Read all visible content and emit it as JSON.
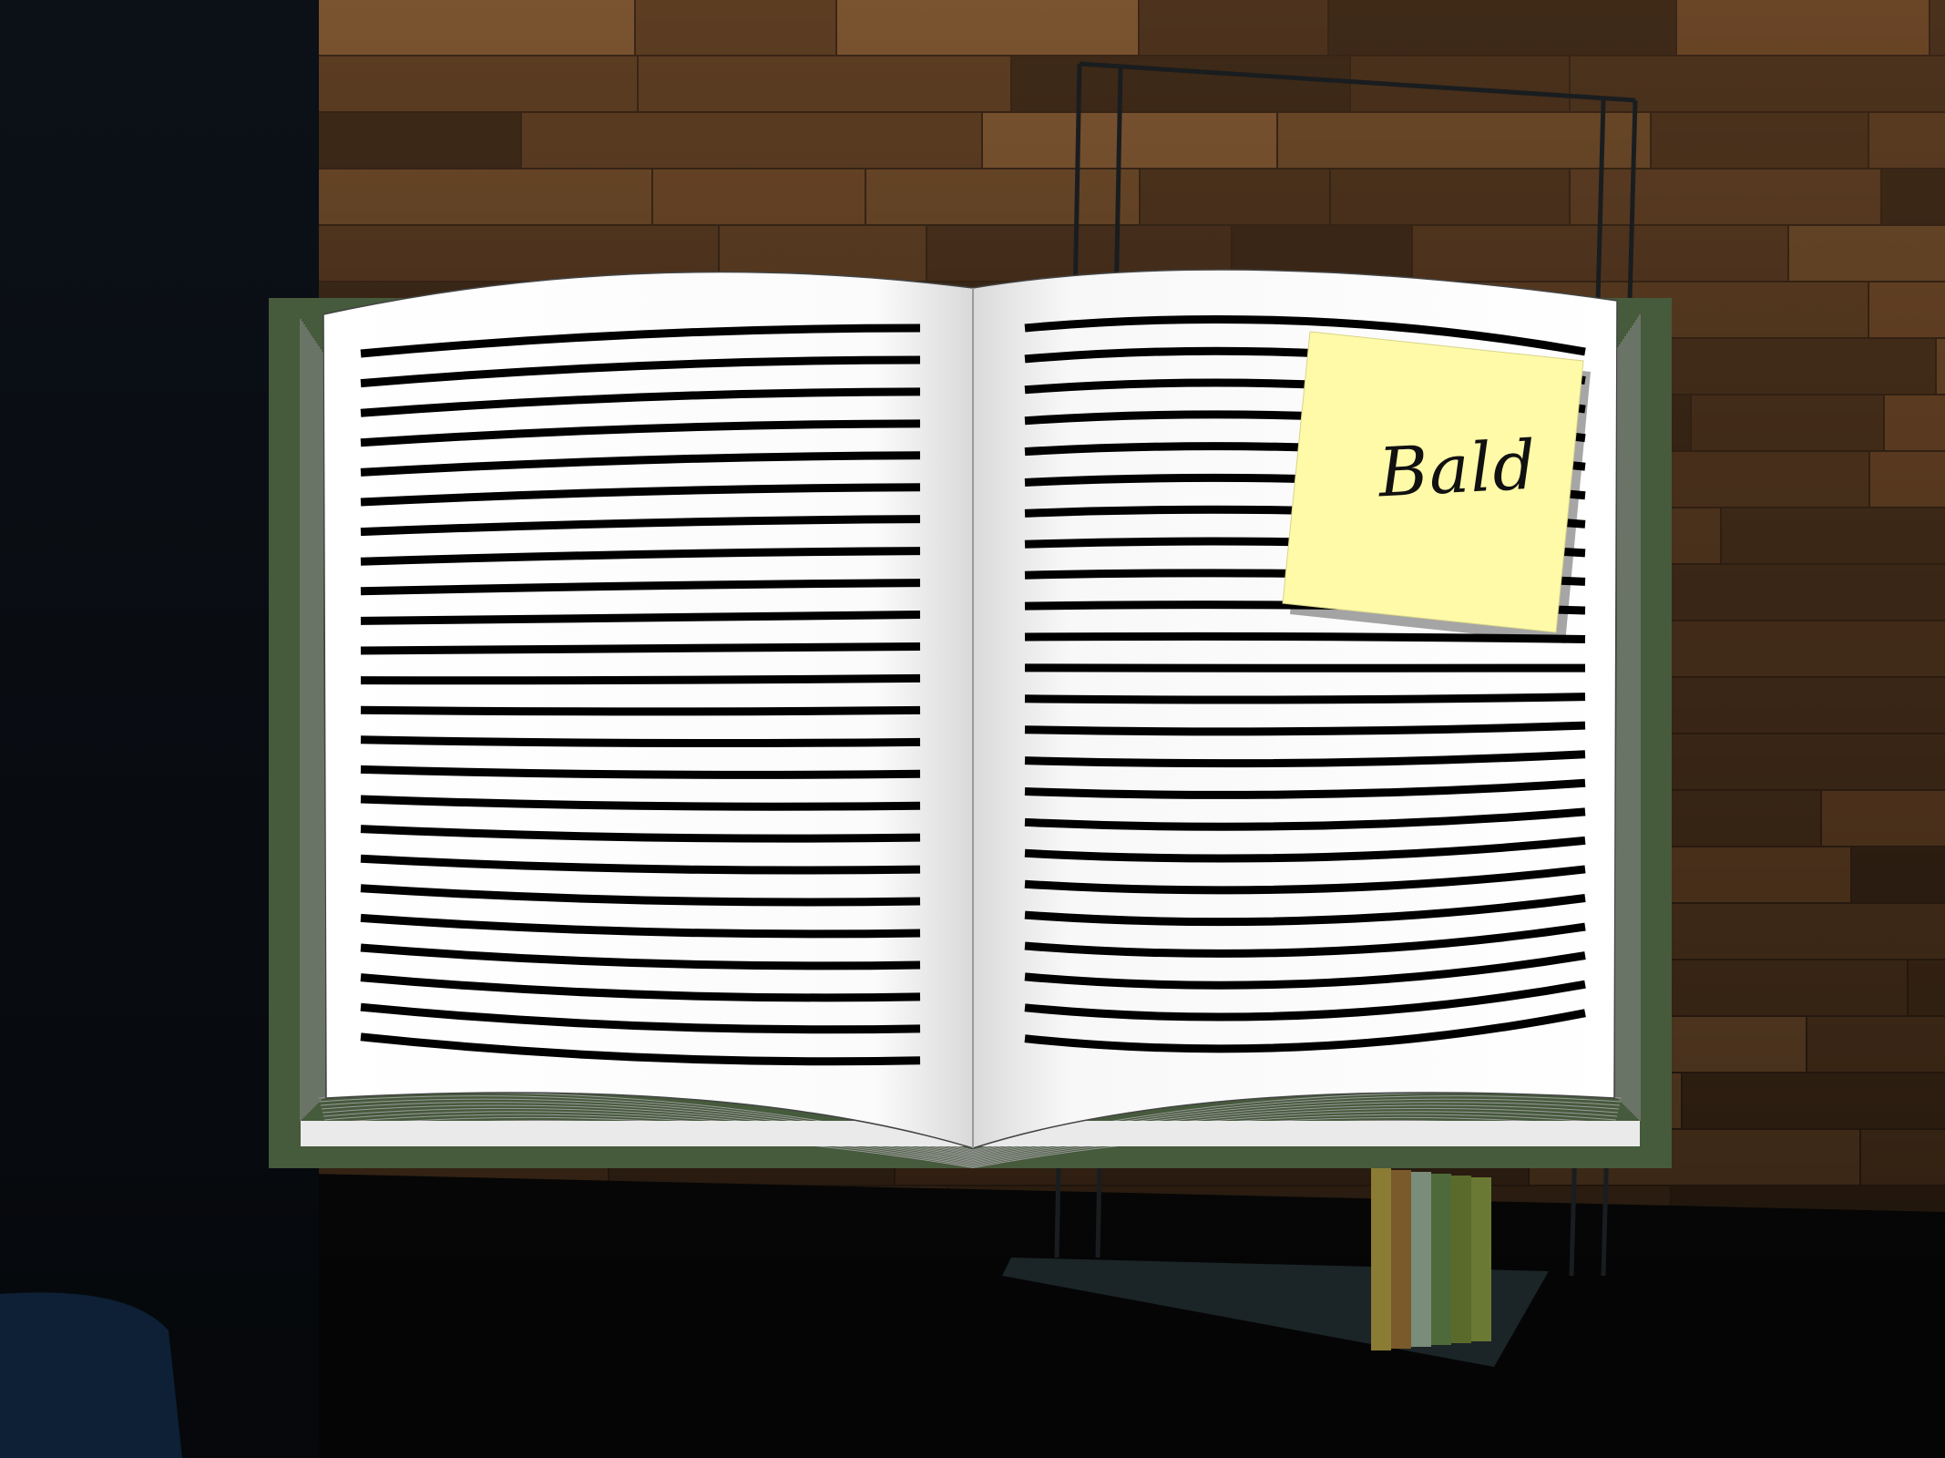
{
  "scene": {
    "type": "open-book-viewer",
    "colors": {
      "background": "#0b0e13",
      "wood_wall": "#5a3c22",
      "book_cover": "#465a3c",
      "page": "#ffffff",
      "text_line": "#000000",
      "sticky_note": "#fffaa8"
    }
  },
  "book": {
    "left_page_lines": 24,
    "right_page_lines": 24
  },
  "sticky_note": {
    "text": "Bald"
  },
  "shelf_books": {
    "colors": [
      "#8a7c34",
      "#7a5a2a",
      "#7a8c7a",
      "#4e6a3a",
      "#5a6a2a",
      "#6a7a34"
    ]
  }
}
